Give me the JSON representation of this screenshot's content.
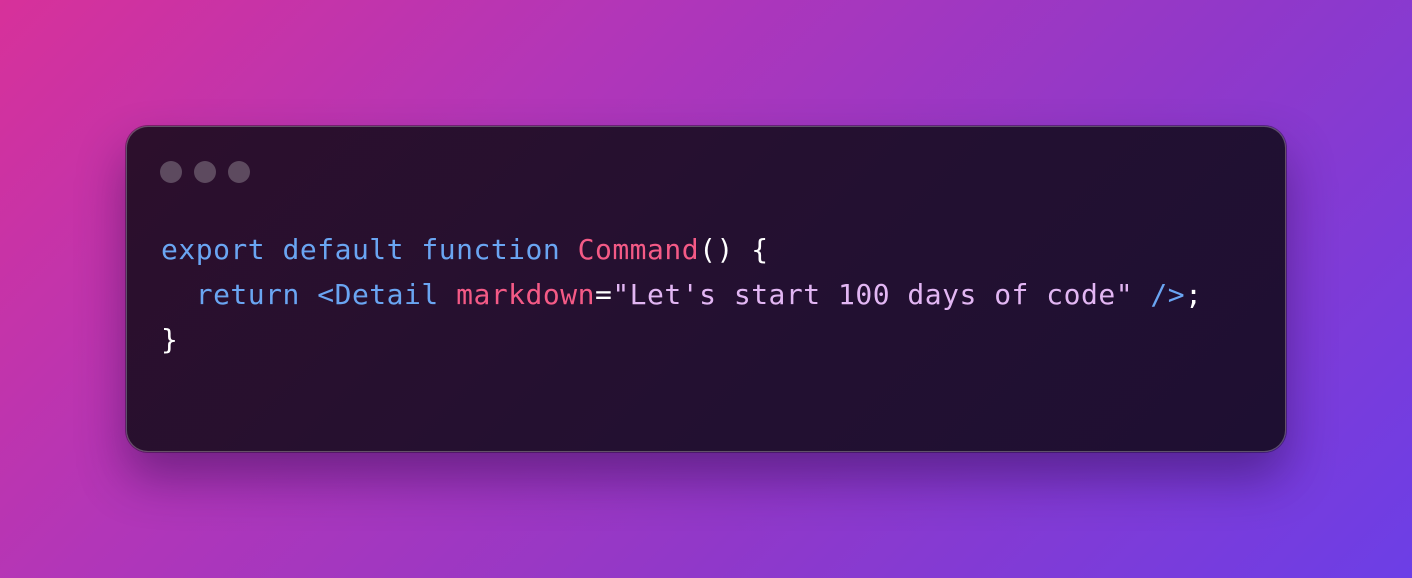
{
  "window": {
    "controls": [
      {
        "name": "close-dot"
      },
      {
        "name": "minimize-dot"
      },
      {
        "name": "maximize-dot"
      }
    ]
  },
  "code": {
    "line1": {
      "kw_export": "export",
      "kw_default": "default",
      "kw_function": "function",
      "fn_name": "Command",
      "parens": "()",
      "brace_open": "{"
    },
    "line2": {
      "kw_return": "return",
      "tag_open": "<Detail",
      "attr_name": "markdown",
      "equals": "=",
      "attr_value": "\"Let's start 100 days of code\"",
      "tag_close": "/>",
      "semicolon": ";"
    },
    "line3": {
      "brace_close": "}"
    }
  },
  "colors": {
    "keyword": "#6aa5f2",
    "function_name": "#f45a86",
    "attribute": "#f45a86",
    "string": "#e2b6f3",
    "punctuation": "#ffffff",
    "window_bg": "#261032",
    "dot": "#5d4a5f"
  }
}
